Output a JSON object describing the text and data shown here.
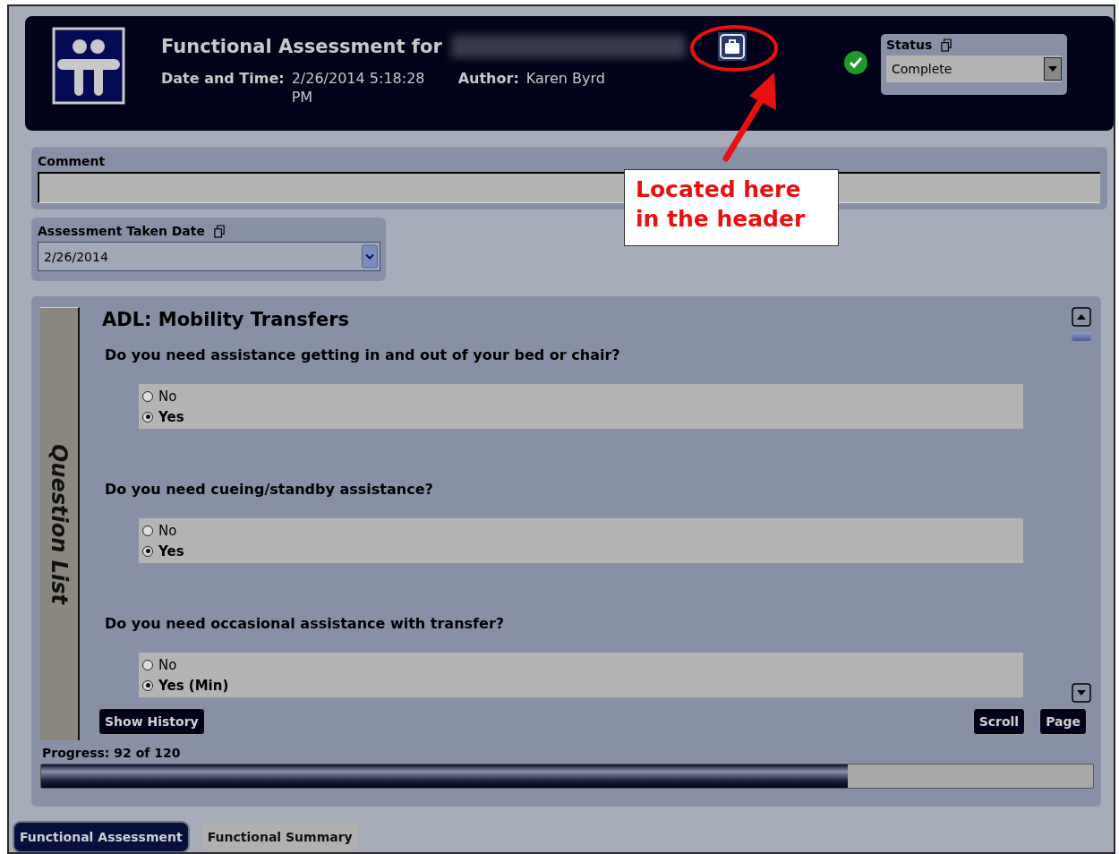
{
  "header": {
    "title": "Functional Assessment for",
    "date_label": "Date and Time:",
    "date_value": "2/26/2014 5:18:28 PM",
    "author_label": "Author:",
    "author_value": "Karen Byrd",
    "status": {
      "label": "Status",
      "value": "Complete"
    }
  },
  "annotation": {
    "text": "Located here in the header"
  },
  "comment": {
    "label": "Comment"
  },
  "assessment_date": {
    "label": "Assessment Taken Date",
    "value": "2/26/2014"
  },
  "side_tab": "Question List",
  "section_title": "ADL: Mobility Transfers",
  "questions": [
    {
      "text": "Do you need assistance getting in and out of your bed or chair?",
      "options": [
        {
          "label": "No",
          "selected": false
        },
        {
          "label": "Yes",
          "selected": true
        }
      ]
    },
    {
      "text": "Do you need cueing/standby assistance?",
      "options": [
        {
          "label": "No",
          "selected": false
        },
        {
          "label": "Yes",
          "selected": true
        }
      ]
    },
    {
      "text": "Do you need occasional assistance with transfer?",
      "options": [
        {
          "label": "No",
          "selected": false
        },
        {
          "label": "Yes (Min)",
          "selected": true
        }
      ]
    }
  ],
  "buttons": {
    "history": "Show History",
    "scroll": "Scroll",
    "page": "Page"
  },
  "progress": {
    "label": "Progress: 92 of 120",
    "level": 0.767
  },
  "tabs": [
    {
      "label": "Functional Assessment",
      "selected": true
    },
    {
      "label": "Functional Summary",
      "selected": false
    }
  ]
}
